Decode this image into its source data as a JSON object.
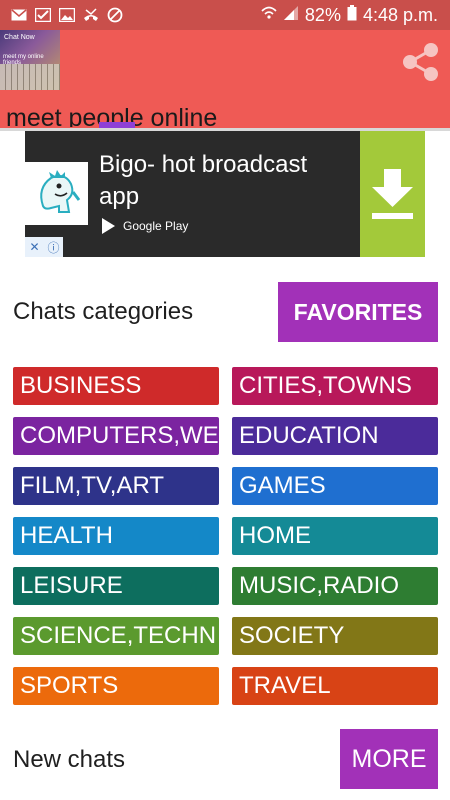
{
  "status_bar": {
    "battery": "82%",
    "time": "4:48 p.m.",
    "icons": [
      "mail-icon",
      "check-icon",
      "image-icon",
      "missed-call-icon",
      "blocked-icon",
      "wifi-icon",
      "signal-icon",
      "battery-icon"
    ]
  },
  "app_bar": {
    "thumb_title": "Chat Now",
    "thumb_caption": "meet my online friends",
    "subtitle": "meet people online",
    "share_icon": "share-icon",
    "color": "#ef5a55"
  },
  "ad": {
    "title": "Bigo- hot broadcast app",
    "store": "Google Play",
    "close_label": "✕",
    "info_label": "ⓘ"
  },
  "categories_section": {
    "title": "Chats categories",
    "favorites_label": "FAVORITES"
  },
  "categories": [
    {
      "label": "BUSINESS",
      "color": "#cf2a2a"
    },
    {
      "label": "CITIES,TOWNS",
      "color": "#b8185a"
    },
    {
      "label": "COMPUTERS,WE",
      "color": "#7b24a0"
    },
    {
      "label": "EDUCATION",
      "color": "#4b2b9a"
    },
    {
      "label": "FILM,TV,ART",
      "color": "#2e338a"
    },
    {
      "label": "GAMES",
      "color": "#1f6fd0"
    },
    {
      "label": "HEALTH",
      "color": "#1488c8"
    },
    {
      "label": "HOME",
      "color": "#148a96"
    },
    {
      "label": "LEISURE",
      "color": "#0d6e5e"
    },
    {
      "label": "MUSIC,RADIO",
      "color": "#2e7d32"
    },
    {
      "label": "SCIENCE,TECHN",
      "color": "#5b9a2e"
    },
    {
      "label": "SOCIETY",
      "color": "#827717"
    },
    {
      "label": "SPORTS",
      "color": "#ec6a0c"
    },
    {
      "label": "TRAVEL",
      "color": "#d84315"
    }
  ],
  "new_chats_section": {
    "title": "New chats",
    "more_label": "MORE"
  }
}
